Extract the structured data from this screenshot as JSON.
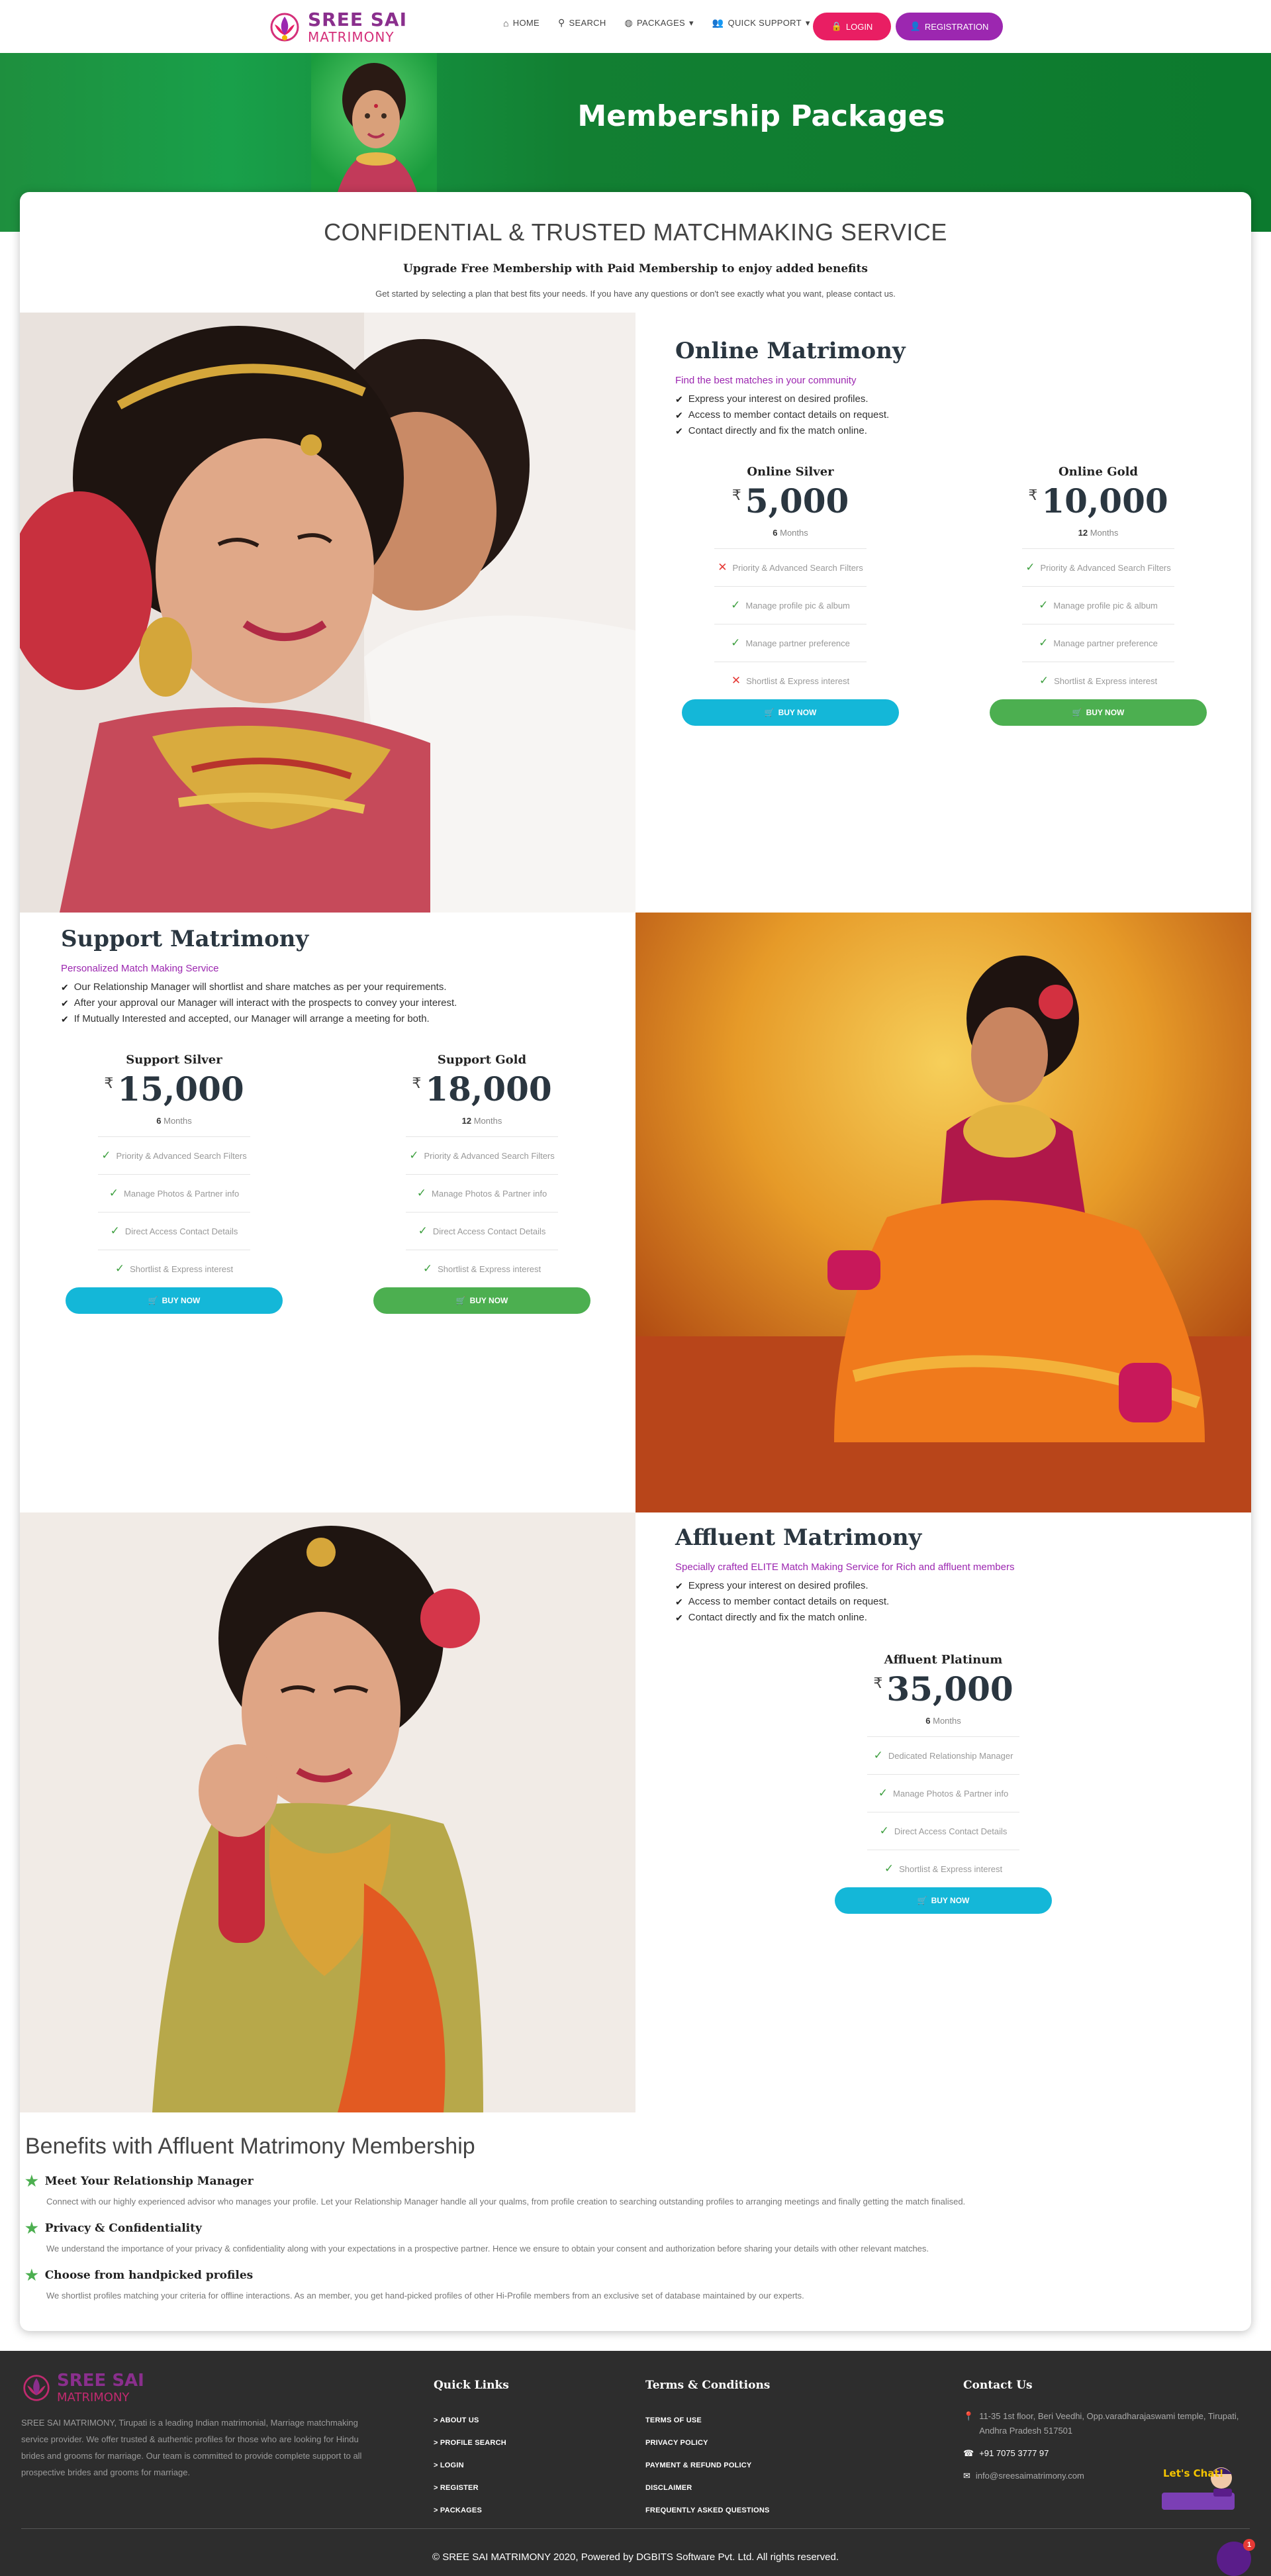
{
  "brand": {
    "name_line1": "SREE SAI",
    "name_line2": "MATRIMONY"
  },
  "nav": {
    "items": [
      {
        "label": "HOME",
        "icon": "home-icon"
      },
      {
        "label": "SEARCH",
        "icon": "search-icon"
      },
      {
        "label": "PACKAGES",
        "icon": "globe-icon"
      },
      {
        "label": "QUICK SUPPORT",
        "icon": "users-icon"
      }
    ],
    "login": "LOGIN",
    "register": "REGISTRATION"
  },
  "hero": {
    "title": "Membership Packages"
  },
  "intro": {
    "heading": "CONFIDENTIAL & TRUSTED MATCHMAKING SERVICE",
    "subheading": "Upgrade Free Membership with Paid Membership to enjoy added benefits",
    "text": "Get started by selecting a plan that best fits your needs. If you have any questions or don't see exactly what you want, please contact us."
  },
  "sections": [
    {
      "title": "Online Matrimony",
      "subtitle": "Find the best matches in your community",
      "bullets": [
        "Express your interest on desired profiles.",
        "Access to member contact details on request.",
        "Contact directly and fix the match online."
      ],
      "plans": [
        {
          "name": "Online Silver",
          "currency": "₹",
          "price": "5,000",
          "months": "6",
          "months_label": "Months",
          "button": "BUY NOW",
          "features": [
            {
              "text": "Priority & Advanced Search Filters",
              "ok": false
            },
            {
              "text": "Manage profile pic & album",
              "ok": true
            },
            {
              "text": "Manage partner preference",
              "ok": true
            },
            {
              "text": "Shortlist & Express interest",
              "ok": false
            }
          ]
        },
        {
          "name": "Online Gold",
          "currency": "₹",
          "price": "10,000",
          "months": "12",
          "months_label": "Months",
          "button": "BUY NOW",
          "features": [
            {
              "text": "Priority & Advanced Search Filters",
              "ok": true
            },
            {
              "text": "Manage profile pic & album",
              "ok": true
            },
            {
              "text": "Manage partner preference",
              "ok": true
            },
            {
              "text": "Shortlist & Express interest",
              "ok": true
            }
          ]
        }
      ]
    },
    {
      "title": "Support Matrimony",
      "subtitle": "Personalized Match Making Service",
      "bullets": [
        "Our Relationship Manager will shortlist and share matches as per your requirements.",
        "After your approval our Manager will interact with the prospects to convey your interest.",
        "If Mutually Interested and accepted, our Manager will arrange a meeting for both."
      ],
      "plans": [
        {
          "name": "Support Silver",
          "currency": "₹",
          "price": "15,000",
          "months": "6",
          "months_label": "Months",
          "button": "BUY NOW",
          "features": [
            {
              "text": "Priority & Advanced Search Filters",
              "ok": true
            },
            {
              "text": "Manage Photos & Partner info",
              "ok": true
            },
            {
              "text": "Direct Access Contact Details",
              "ok": true
            },
            {
              "text": "Shortlist & Express interest",
              "ok": true
            }
          ]
        },
        {
          "name": "Support Gold",
          "currency": "₹",
          "price": "18,000",
          "months": "12",
          "months_label": "Months",
          "button": "BUY NOW",
          "features": [
            {
              "text": "Priority & Advanced Search Filters",
              "ok": true
            },
            {
              "text": "Manage Photos & Partner info",
              "ok": true
            },
            {
              "text": "Direct Access Contact Details",
              "ok": true
            },
            {
              "text": "Shortlist & Express interest",
              "ok": true
            }
          ]
        }
      ]
    },
    {
      "title": "Affluent Matrimony",
      "subtitle": "Specially crafted ELITE Match Making Service for Rich and affluent members",
      "bullets": [
        "Express your interest on desired profiles.",
        "Access to member contact details on request.",
        "Contact directly and fix the match online."
      ],
      "plans": [
        {
          "name": "Affluent Platinum",
          "currency": "₹",
          "price": "35,000",
          "months": "6",
          "months_label": "Months",
          "button": "BUY NOW",
          "features": [
            {
              "text": "Dedicated Relationship Manager",
              "ok": true
            },
            {
              "text": "Manage Photos & Partner info",
              "ok": true
            },
            {
              "text": "Direct Access Contact Details",
              "ok": true
            },
            {
              "text": "Shortlist & Express interest",
              "ok": true
            }
          ]
        }
      ]
    }
  ],
  "benefits": {
    "heading": "Benefits with Affluent Matrimony Membership",
    "items": [
      {
        "title": "Meet Your Relationship Manager",
        "text": "Connect with our highly experienced advisor who manages your profile. Let your Relationship Manager handle all your qualms, from profile creation to searching outstanding profiles to arranging meetings and finally getting the match finalised."
      },
      {
        "title": "Privacy & Confidentiality",
        "text": "We understand the importance of your privacy & confidentiality along with your expectations in a prospective partner. Hence we ensure to obtain your consent and authorization before sharing your details with other relevant matches."
      },
      {
        "title": "Choose from handpicked profiles",
        "text": "We shortlist profiles matching your criteria for offline interactions. As an member, you get hand-picked profiles of other Hi-Profile members from an exclusive set of database maintained by our experts."
      }
    ]
  },
  "footer": {
    "about": "SREE SAI MATRIMONY, Tirupati is a leading Indian matrimonial, Marriage matchmaking service provider. We offer trusted & authentic profiles for those who are looking for Hindu brides and grooms for marriage. Our team is committed to provide complete support to all prospective brides and grooms for marriage.",
    "quick_links_title": "Quick Links",
    "quick_links": [
      "> ABOUT US",
      "> PROFILE SEARCH",
      "> LOGIN",
      "> REGISTER",
      "> PACKAGES"
    ],
    "terms_title": "Terms & Conditions",
    "terms": [
      "TERMS OF USE",
      "PRIVACY POLICY",
      "PAYMENT & REFUND POLICY",
      "DISCLAIMER",
      "FREQUENTLY ASKED QUESTIONS"
    ],
    "contact_title": "Contact Us",
    "address": "11-35 1st floor, Beri Veedhi, Opp.varadharajaswami temple, Tirupati, Andhra Pradesh 517501",
    "phone": "+91 7075 3777 97",
    "email": "info@sreesaimatrimony.com",
    "copyright": "© SREE SAI MATRIMONY 2020, Powered by DGBITS Software Pvt. Ltd. All rights reserved.",
    "chat_label": "Let's Chat!",
    "chat_badge": "1"
  },
  "colors": {
    "accent_pink": "#e91e63",
    "accent_purple": "#9c27b0",
    "cyan": "#14b7d8",
    "green": "#4caf50",
    "hero_green": "#127f32"
  }
}
